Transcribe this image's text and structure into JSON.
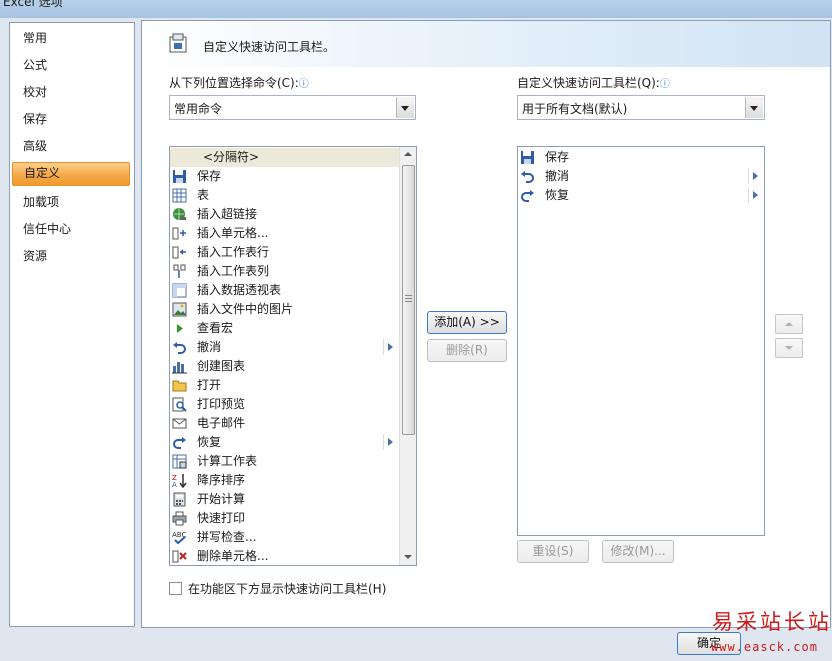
{
  "window": {
    "title": "Excel 选项"
  },
  "sidebar": {
    "items": [
      {
        "label": "常用"
      },
      {
        "label": "公式"
      },
      {
        "label": "校对"
      },
      {
        "label": "保存"
      },
      {
        "label": "高级"
      },
      {
        "label": "自定义",
        "selected": true
      },
      {
        "label": "加载项"
      },
      {
        "label": "信任中心"
      },
      {
        "label": "资源"
      }
    ]
  },
  "header": {
    "title": "自定义快速访问工具栏。"
  },
  "left_panel": {
    "label": "从下列位置选择命令(C):",
    "combo_value": "常用命令",
    "commands": [
      {
        "label": "<分隔符>",
        "icon": "none"
      },
      {
        "label": "保存",
        "icon": "save-icon"
      },
      {
        "label": "表",
        "icon": "table-icon"
      },
      {
        "label": "插入超链接",
        "icon": "hyperlink-icon"
      },
      {
        "label": "插入单元格...",
        "icon": "insert-cells-icon"
      },
      {
        "label": "插入工作表行",
        "icon": "insert-rows-icon"
      },
      {
        "label": "插入工作表列",
        "icon": "insert-columns-icon"
      },
      {
        "label": "插入数据透视表",
        "icon": "pivot-table-icon"
      },
      {
        "label": "插入文件中的图片",
        "icon": "picture-icon"
      },
      {
        "label": "查看宏",
        "icon": "macro-play-icon"
      },
      {
        "label": "撤消",
        "icon": "undo-icon",
        "submenu": true
      },
      {
        "label": "创建图表",
        "icon": "chart-icon"
      },
      {
        "label": "打开",
        "icon": "open-folder-icon"
      },
      {
        "label": "打印预览",
        "icon": "print-preview-icon"
      },
      {
        "label": "电子邮件",
        "icon": "email-icon"
      },
      {
        "label": "恢复",
        "icon": "redo-icon",
        "submenu": true
      },
      {
        "label": "计算工作表",
        "icon": "calculate-sheet-icon"
      },
      {
        "label": "降序排序",
        "icon": "sort-desc-icon"
      },
      {
        "label": "开始计算",
        "icon": "calculate-icon"
      },
      {
        "label": "快速打印",
        "icon": "printer-icon"
      },
      {
        "label": "拼写检查...",
        "icon": "spelling-icon"
      },
      {
        "label": "删除单元格...",
        "icon": "delete-cells-icon"
      }
    ]
  },
  "right_panel": {
    "label": "自定义快速访问工具栏(Q):",
    "combo_value": "用于所有文档(默认)",
    "commands": [
      {
        "label": "保存",
        "icon": "save-icon"
      },
      {
        "label": "撤消",
        "icon": "undo-icon",
        "submenu": true
      },
      {
        "label": "恢复",
        "icon": "redo-icon",
        "submenu": true
      }
    ]
  },
  "buttons": {
    "add": "添加(A) >>",
    "remove": "删除(R)",
    "reset": "重设(S)",
    "modify": "修改(M)...",
    "ok": "确定"
  },
  "checkbox": {
    "label": "在功能区下方显示快速访问工具栏(H)",
    "checked": false
  },
  "info_glyph": "ⓘ",
  "watermark": {
    "line1": "易采站长站",
    "line2": "www.easck.com"
  },
  "colors": {
    "selected_nav": "#f6a94a",
    "watermark": "#cc1b1b",
    "info": "#3b6fbf"
  }
}
